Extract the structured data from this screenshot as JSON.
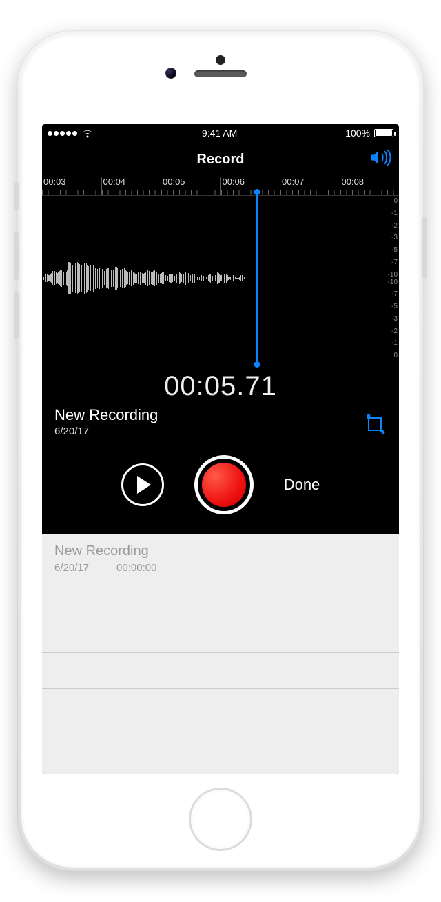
{
  "status": {
    "signal_dots": 5,
    "time": "9:41 AM",
    "battery_pct": "100%"
  },
  "nav": {
    "title": "Record"
  },
  "timeline": {
    "labels": [
      "00:03",
      "00:04",
      "00:05",
      "00:06",
      "00:07",
      "00:08"
    ]
  },
  "db_scale": [
    "0",
    "-1",
    "-2",
    "-3",
    "-5",
    "-7",
    "-10"
  ],
  "recording": {
    "timer": "00:05.71",
    "name": "New Recording",
    "date": "6/20/17"
  },
  "controls": {
    "done_label": "Done"
  },
  "list": {
    "items": [
      {
        "title": "New Recording",
        "date": "6/20/17",
        "duration": "00:00:00"
      }
    ]
  },
  "colors": {
    "accent": "#0b84ff",
    "record": "#e11"
  }
}
